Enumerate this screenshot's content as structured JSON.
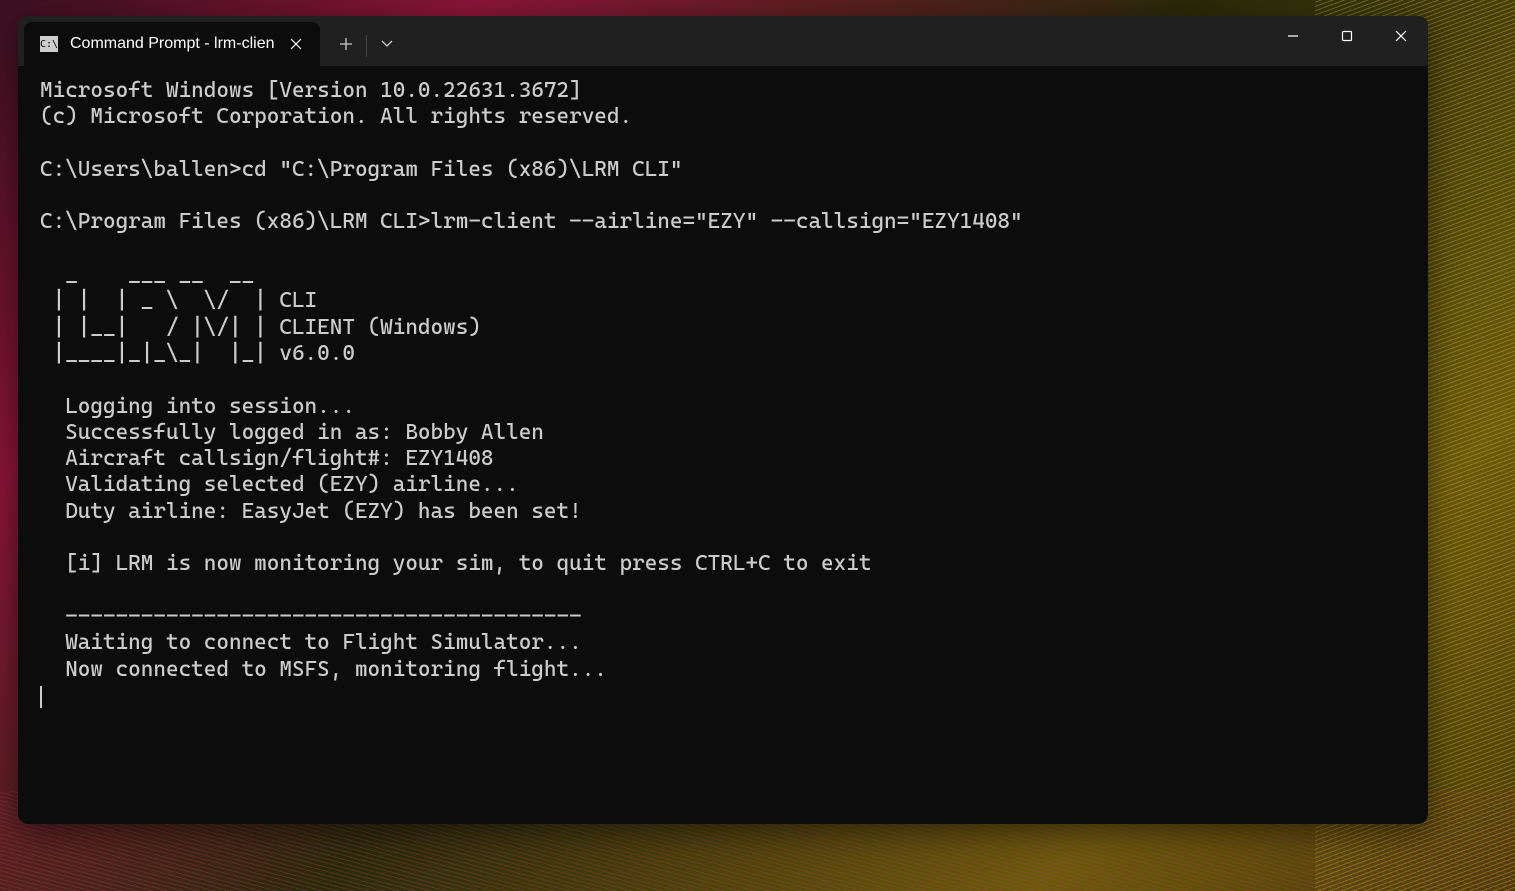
{
  "titlebar": {
    "tab_title": "Command Prompt - lrm-clien"
  },
  "terminal": {
    "line1": "Microsoft Windows [Version 10.0.22631.3672]",
    "line2": "(c) Microsoft Corporation. All rights reserved.",
    "line3": "",
    "line4": "C:\\Users\\ballen>cd \"C:\\Program Files (x86)\\LRM CLI\"",
    "line5": "",
    "line6": "C:\\Program Files (x86)\\LRM CLI>lrm-client --airline=\"EZY\" --callsign=\"EZY1408\"",
    "line7": "",
    "line8": "  _    ___ __  __",
    "line9": " | |  | _ \\  \\/  | CLI",
    "line10": " | |__|   / |\\/| | CLIENT (Windows)",
    "line11": " |____|_|_\\_|  |_| v6.0.0",
    "line12": "",
    "line13": "  Logging into session...",
    "line14": "  Successfully logged in as: Bobby Allen",
    "line15": "  Aircraft callsign/flight#: EZY1408",
    "line16": "  Validating selected (EZY) airline...",
    "line17": "  Duty airline: EasyJet (EZY) has been set!",
    "line18": "",
    "line19": "  [i] LRM is now monitoring your sim, to quit press CTRL+C to exit",
    "line20": "",
    "line21": "  -----------------------------------------",
    "line22": "  Waiting to connect to Flight Simulator...",
    "line23": "  Now connected to MSFS, monitoring flight..."
  }
}
